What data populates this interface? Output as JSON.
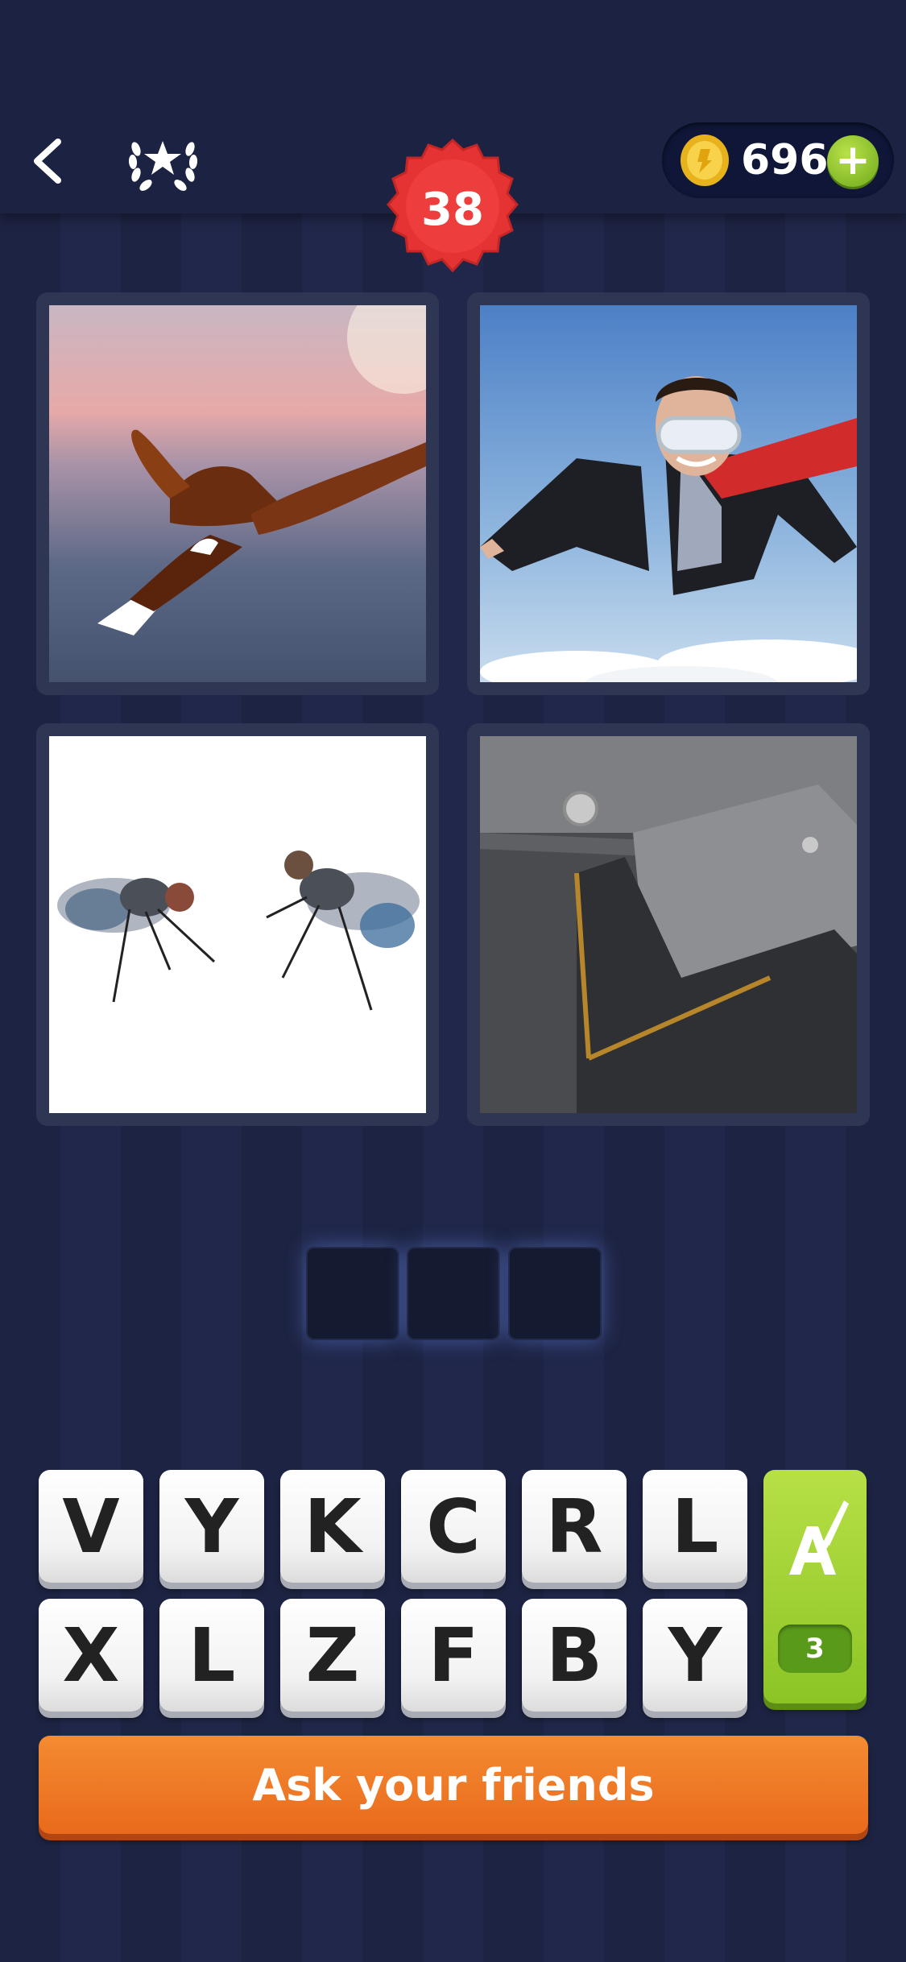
{
  "header": {
    "level": "38",
    "coins": "696",
    "plus_label": "+"
  },
  "answer": {
    "length": 3
  },
  "letters": {
    "row1": [
      "V",
      "Y",
      "K",
      "C",
      "R",
      "L"
    ],
    "row2": [
      "X",
      "L",
      "Z",
      "F",
      "B",
      "Y"
    ]
  },
  "hint": {
    "count": "3"
  },
  "ask_button": {
    "label": "Ask your friends"
  },
  "colors": {
    "background": "#1e2444",
    "badge_red": "#e53333",
    "hint_green": "#8cc426",
    "ask_orange": "#ee7a26"
  }
}
